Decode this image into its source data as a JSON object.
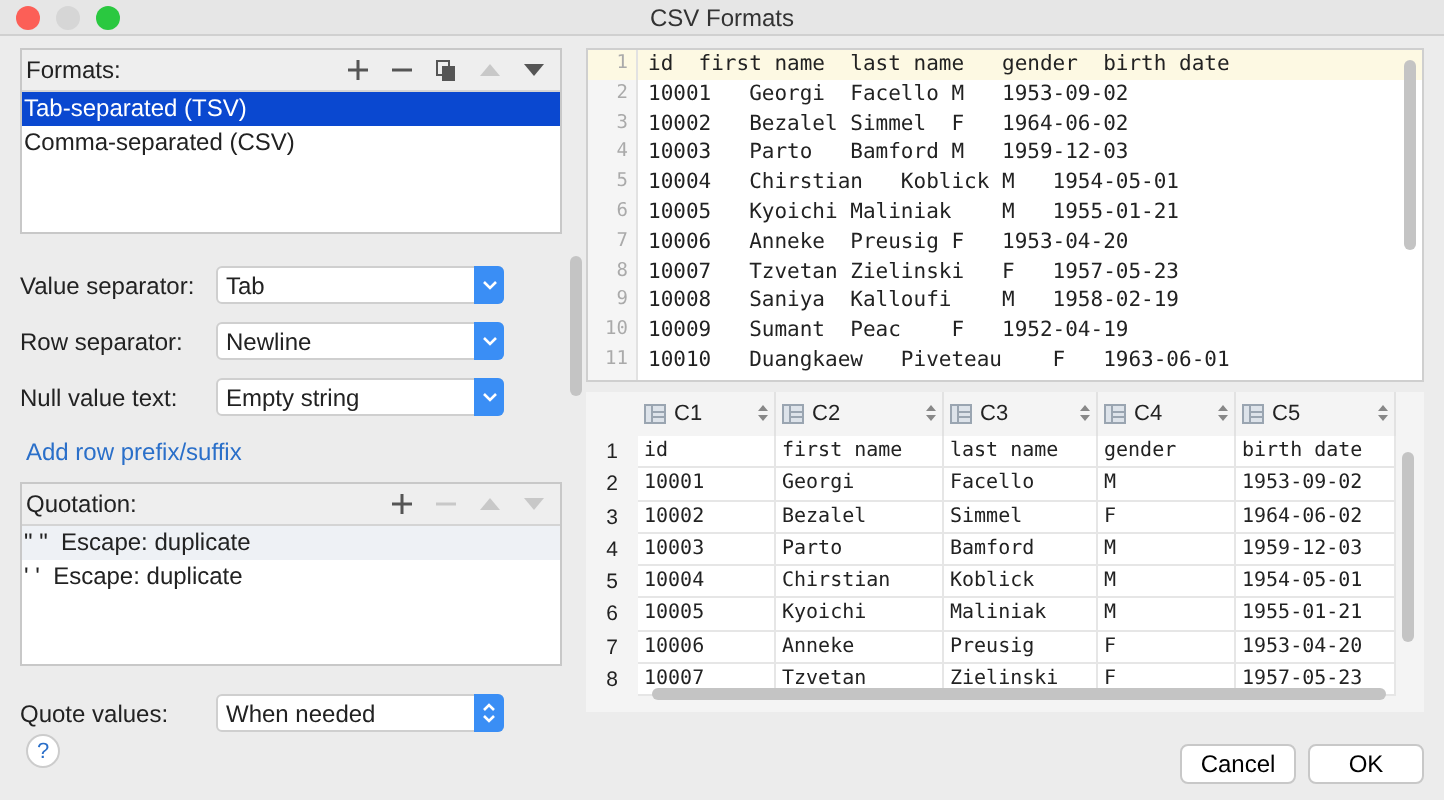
{
  "window": {
    "title": "CSV Formats"
  },
  "formats": {
    "label": "Formats:",
    "tools": [
      {
        "kind": "add",
        "disabled": false
      },
      {
        "kind": "remove",
        "disabled": false
      },
      {
        "kind": "copy",
        "disabled": false
      },
      {
        "kind": "up",
        "disabled": true
      },
      {
        "kind": "down",
        "disabled": false
      }
    ],
    "items": [
      {
        "label": "Tab-separated (TSV)",
        "selected": true
      },
      {
        "label": "Comma-separated (CSV)",
        "selected": false
      }
    ]
  },
  "settings": [
    {
      "label": "Value separator:",
      "value": "Tab"
    },
    {
      "label": "Row separator:",
      "value": "Newline"
    },
    {
      "label": "Null value text:",
      "value": "Empty string"
    }
  ],
  "link": "Add row prefix/suffix",
  "quotation": {
    "label": "Quotation:",
    "tools": [
      {
        "kind": "add",
        "disabled": false
      },
      {
        "kind": "remove",
        "disabled": true
      },
      {
        "kind": "up",
        "disabled": true
      },
      {
        "kind": "down",
        "disabled": true
      }
    ],
    "items": [
      {
        "label": "\" \"  Escape: duplicate",
        "selected": true
      },
      {
        "label": "' '  Escape: duplicate",
        "selected": false
      }
    ]
  },
  "quote_values": {
    "label": "Quote values:",
    "value": "When needed"
  },
  "editor": {
    "lines": [
      {
        "number": "1",
        "text": "id  first name  last name   gender  birth date"
      },
      {
        "number": "2",
        "text": "10001   Georgi  Facello M   1953-09-02"
      },
      {
        "number": "3",
        "text": "10002   Bezalel Simmel  F   1964-06-02"
      },
      {
        "number": "4",
        "text": "10003   Parto   Bamford M   1959-12-03"
      },
      {
        "number": "5",
        "text": "10004   Chirstian   Koblick M   1954-05-01"
      },
      {
        "number": "6",
        "text": "10005   Kyoichi Maliniak    M   1955-01-21"
      },
      {
        "number": "7",
        "text": "10006   Anneke  Preusig F   1953-04-20"
      },
      {
        "number": "8",
        "text": "10007   Tzvetan Zielinski   F   1957-05-23"
      },
      {
        "number": "9",
        "text": "10008   Saniya  Kalloufi    M   1958-02-19"
      },
      {
        "number": "10",
        "text": "10009   Sumant  Peac    F   1952-04-19"
      },
      {
        "number": "11",
        "text": "10010   Duangkaew   Piveteau    F   1963-06-01"
      }
    ]
  },
  "table": {
    "columns": [
      "C1",
      "C2",
      "C3",
      "C4",
      "C5"
    ],
    "rows": [
      {
        "number": "1",
        "cells": [
          "id",
          "first name",
          "last name",
          "gender",
          "birth date"
        ]
      },
      {
        "number": "2",
        "cells": [
          "10001",
          "Georgi",
          "Facello",
          "M",
          "1953-09-02"
        ]
      },
      {
        "number": "3",
        "cells": [
          "10002",
          "Bezalel",
          "Simmel",
          "F",
          "1964-06-02"
        ]
      },
      {
        "number": "4",
        "cells": [
          "10003",
          "Parto",
          "Bamford",
          "M",
          "1959-12-03"
        ]
      },
      {
        "number": "5",
        "cells": [
          "10004",
          "Chirstian",
          "Koblick",
          "M",
          "1954-05-01"
        ]
      },
      {
        "number": "6",
        "cells": [
          "10005",
          "Kyoichi",
          "Maliniak",
          "M",
          "1955-01-21"
        ]
      },
      {
        "number": "7",
        "cells": [
          "10006",
          "Anneke",
          "Preusig",
          "F",
          "1953-04-20"
        ]
      },
      {
        "number": "8",
        "cells": [
          "10007",
          "Tzvetan",
          "Zielinski",
          "F",
          "1957-05-23"
        ]
      }
    ]
  },
  "buttons": [
    "Cancel",
    "OK"
  ],
  "help": "?"
}
